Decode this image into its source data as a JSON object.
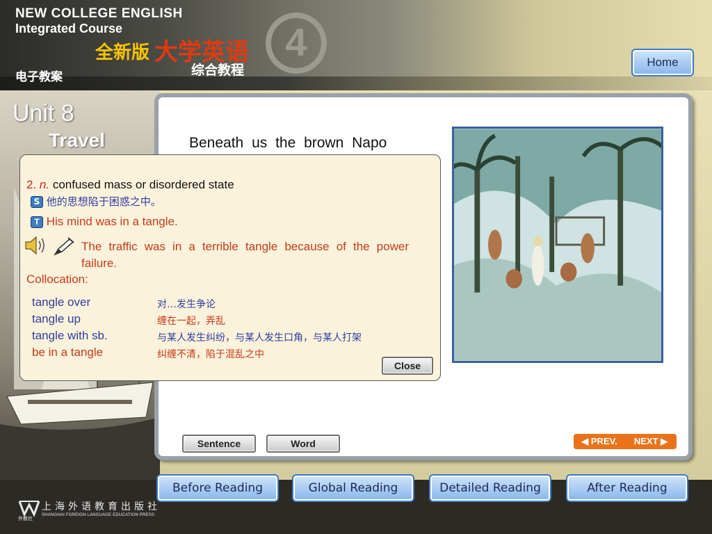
{
  "header": {
    "title_en_line1": "NEW COLLEGE ENGLISH",
    "title_en_line2": "Integrated Course",
    "title_cn_edition": "全新版",
    "title_cn_main": "大学英语",
    "title_cn_sub": "综合教程",
    "book_number": "4",
    "courseware_label": "电子教案",
    "home_label": "Home"
  },
  "unit": {
    "number_label": "Unit 8",
    "title": "Travel"
  },
  "passage": {
    "text": "Beneath us the brown Napo"
  },
  "popup": {
    "definition_number": "2.",
    "definition_pos": "n.",
    "definition_text": "confused mass or disordered state",
    "example_cn_icon": "S",
    "example_cn": "他的思想陷于困惑之中。",
    "example_en_icon": "T",
    "example_en": "His mind was in a tangle.",
    "example_sentence": "The traffic was in a terrible tangle because of the power failure.",
    "collocation_label": "Collocation:",
    "collocations": [
      {
        "phrase": "tangle over",
        "meaning": "对…发生争论"
      },
      {
        "phrase": "tangle up",
        "meaning": "缠在一起，弄乱"
      },
      {
        "phrase": "tangle with sb.",
        "meaning": "与某人发生纠纷，与某人发生口角，与某人打架"
      },
      {
        "phrase": "be in a tangle",
        "meaning": "纠缠不清，陷于混乱之中"
      }
    ],
    "close_label": "Close"
  },
  "controls": {
    "sentence_label": "Sentence",
    "word_label": "Word",
    "prev_label": "◀ PREV.",
    "next_label": "NEXT ▶"
  },
  "tabs": [
    {
      "label": "Before Reading"
    },
    {
      "label": "Global Reading"
    },
    {
      "label": "Detailed Reading"
    },
    {
      "label": "After Reading"
    }
  ],
  "publisher": {
    "name_cn": "上海外语教育出版社",
    "name_en": "SHANGHAI FOREIGN LANGUAGE EDUCATION PRESS",
    "short_cn": "外教社"
  },
  "colors": {
    "accent_blue": "#3e78c4",
    "nav_orange": "#e8731a",
    "text_red": "#c43a18",
    "text_blue": "#2d3e9c"
  },
  "icons": [
    "speaker-icon",
    "pen-icon",
    "publisher-logo-icon"
  ]
}
